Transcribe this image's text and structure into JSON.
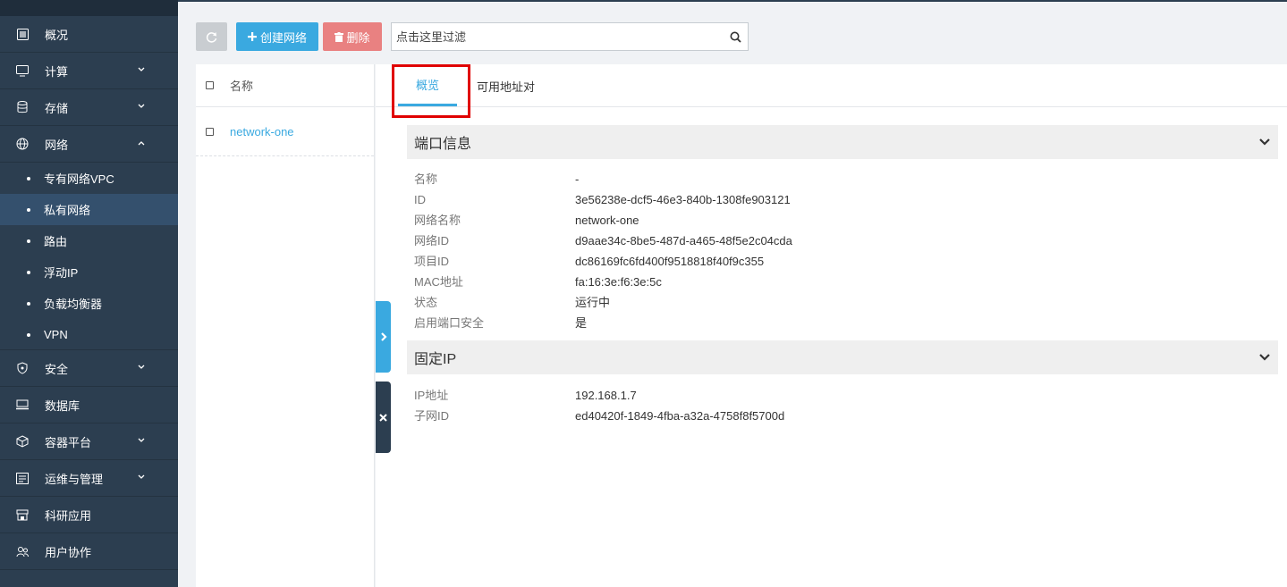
{
  "sidebar": {
    "items": [
      {
        "label": "概况",
        "icon": "dashboard-icon"
      },
      {
        "label": "计算",
        "icon": "monitor-icon"
      },
      {
        "label": "存储",
        "icon": "database-icon"
      },
      {
        "label": "网络",
        "icon": "network-icon"
      }
    ],
    "network_sub": [
      {
        "label": "专有网络VPC"
      },
      {
        "label": "私有网络"
      },
      {
        "label": "路由"
      },
      {
        "label": "浮动IP"
      },
      {
        "label": "负载均衡器"
      },
      {
        "label": "VPN"
      }
    ],
    "items_after": [
      {
        "label": "安全",
        "icon": "shield-icon"
      },
      {
        "label": "数据库",
        "icon": "database-server-icon"
      },
      {
        "label": "容器平台",
        "icon": "container-icon"
      },
      {
        "label": "运维与管理",
        "icon": "ops-icon"
      },
      {
        "label": "科研应用",
        "icon": "store-icon"
      },
      {
        "label": "用户协作",
        "icon": "users-icon"
      }
    ]
  },
  "toolbar": {
    "create_label": "创建网络",
    "delete_label": "删除",
    "search_placeholder": "点击这里过滤"
  },
  "list": {
    "header": "名称",
    "rows": [
      {
        "name": "network-one"
      }
    ]
  },
  "tabs": {
    "overview": "概览",
    "address_pairs": "可用地址对"
  },
  "port_info": {
    "title": "端口信息",
    "fields": [
      {
        "key": "名称",
        "value": "-"
      },
      {
        "key": "ID",
        "value": "3e56238e-dcf5-46e3-840b-1308fe903121"
      },
      {
        "key": "网络名称",
        "value": "network-one"
      },
      {
        "key": "网络ID",
        "value": "d9aae34c-8be5-487d-a465-48f5e2c04cda"
      },
      {
        "key": "项目ID",
        "value": "dc86169fc6fd400f9518818f40f9c355"
      },
      {
        "key": "MAC地址",
        "value": "fa:16:3e:f6:3e:5c"
      },
      {
        "key": "状态",
        "value": "运行中"
      },
      {
        "key": "启用端口安全",
        "value": "是"
      }
    ]
  },
  "fixed_ip": {
    "title": "固定IP",
    "fields": [
      {
        "key": "IP地址",
        "value": "192.168.1.7"
      },
      {
        "key": "子网ID",
        "value": "ed40420f-1849-4fba-a32a-4758f8f5700d"
      }
    ]
  },
  "colors": {
    "sidebar_bg": "#2c3e50",
    "accent": "#3aa9e0",
    "danger": "#e98181",
    "highlight": "#e00000"
  }
}
